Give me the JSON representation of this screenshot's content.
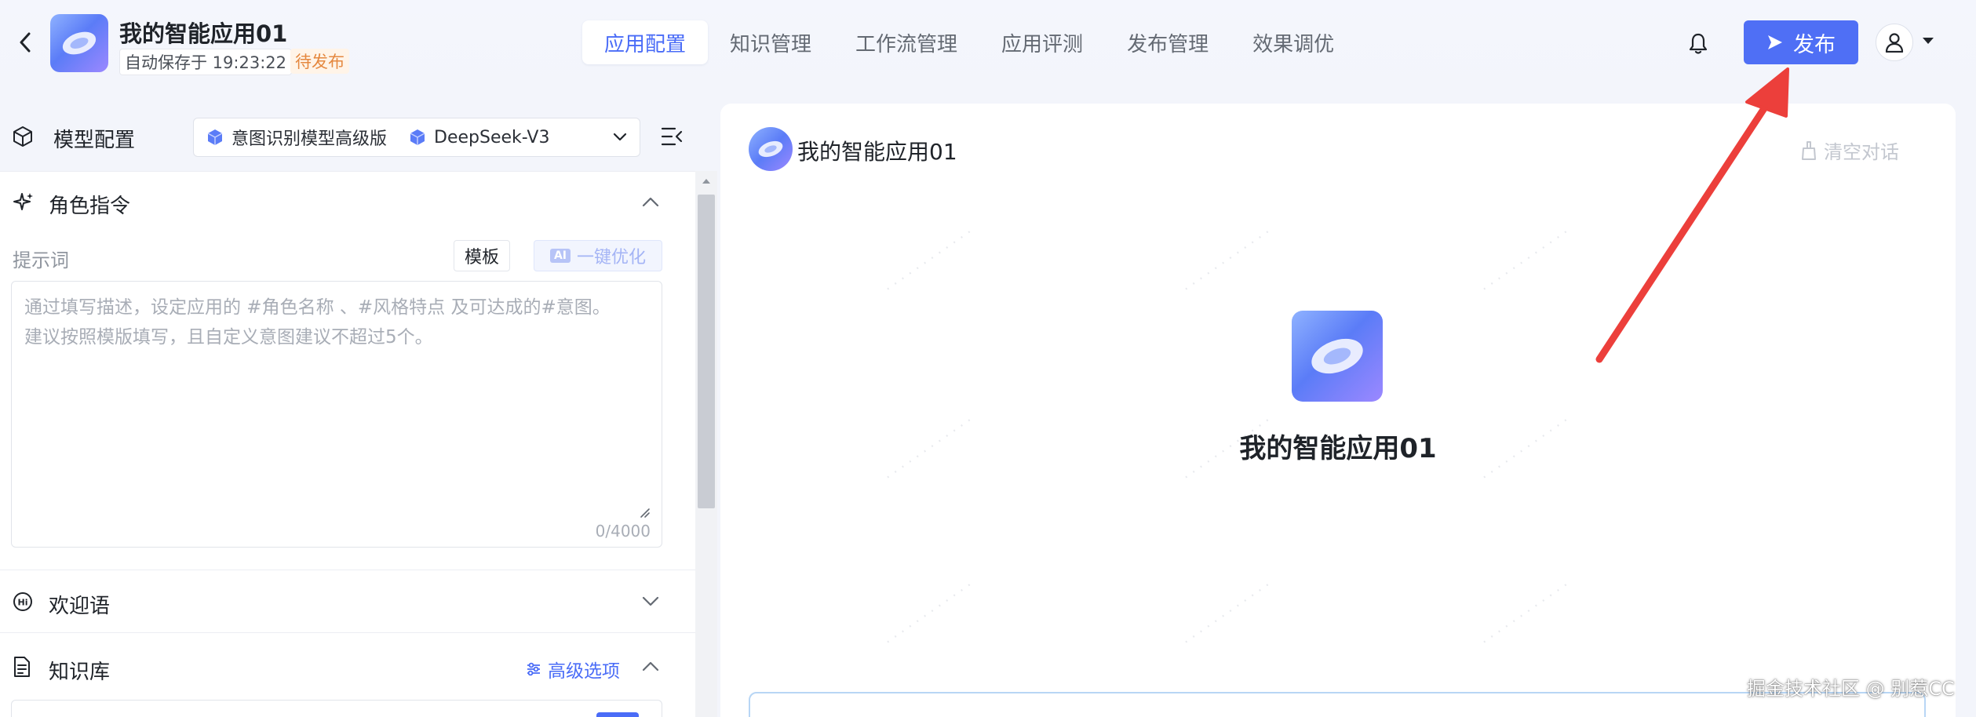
{
  "header": {
    "app_title": "我的智能应用01",
    "autosave_text": "自动保存于 19:23:22",
    "status_badge": "待发布",
    "tabs": [
      {
        "label": "应用配置",
        "active": true
      },
      {
        "label": "知识管理",
        "active": false
      },
      {
        "label": "工作流管理",
        "active": false
      },
      {
        "label": "应用评测",
        "active": false
      },
      {
        "label": "发布管理",
        "active": false
      },
      {
        "label": "效果调优",
        "active": false
      }
    ],
    "publish_label": "发布",
    "icons": {
      "back": "chevron-left-icon",
      "bell": "bell-icon",
      "user": "user-icon",
      "caret": "caret-down-icon"
    }
  },
  "model_config": {
    "label": "模型配置",
    "intent_model": "意图识别模型高级版",
    "llm_model": "DeepSeek-V3"
  },
  "role_instruction": {
    "title": "角色指令",
    "prompt_label": "提示词",
    "template_button": "模板",
    "ai_tag": "AI",
    "optimize_button": "一键优化",
    "placeholder": "通过填写描述，设定应用的 #角色名称 、#风格特点 及可达成的#意图。\n建议按照模版填写，且自定义意图建议不超过5个。",
    "char_count": "0/4000"
  },
  "welcome": {
    "title": "欢迎语"
  },
  "knowledge": {
    "title": "知识库",
    "advanced_options": "高级选项"
  },
  "chat": {
    "bot_name": "我的智能应用01",
    "clear_label": "清空对话",
    "center_name": "我的智能应用01"
  },
  "footer": {
    "watermark": "掘金技术社区 @ 别惹CC"
  },
  "colors": {
    "primary": "#4f6ff5",
    "status_orange": "#e5883f",
    "annotation_red": "#ec3f3b"
  }
}
